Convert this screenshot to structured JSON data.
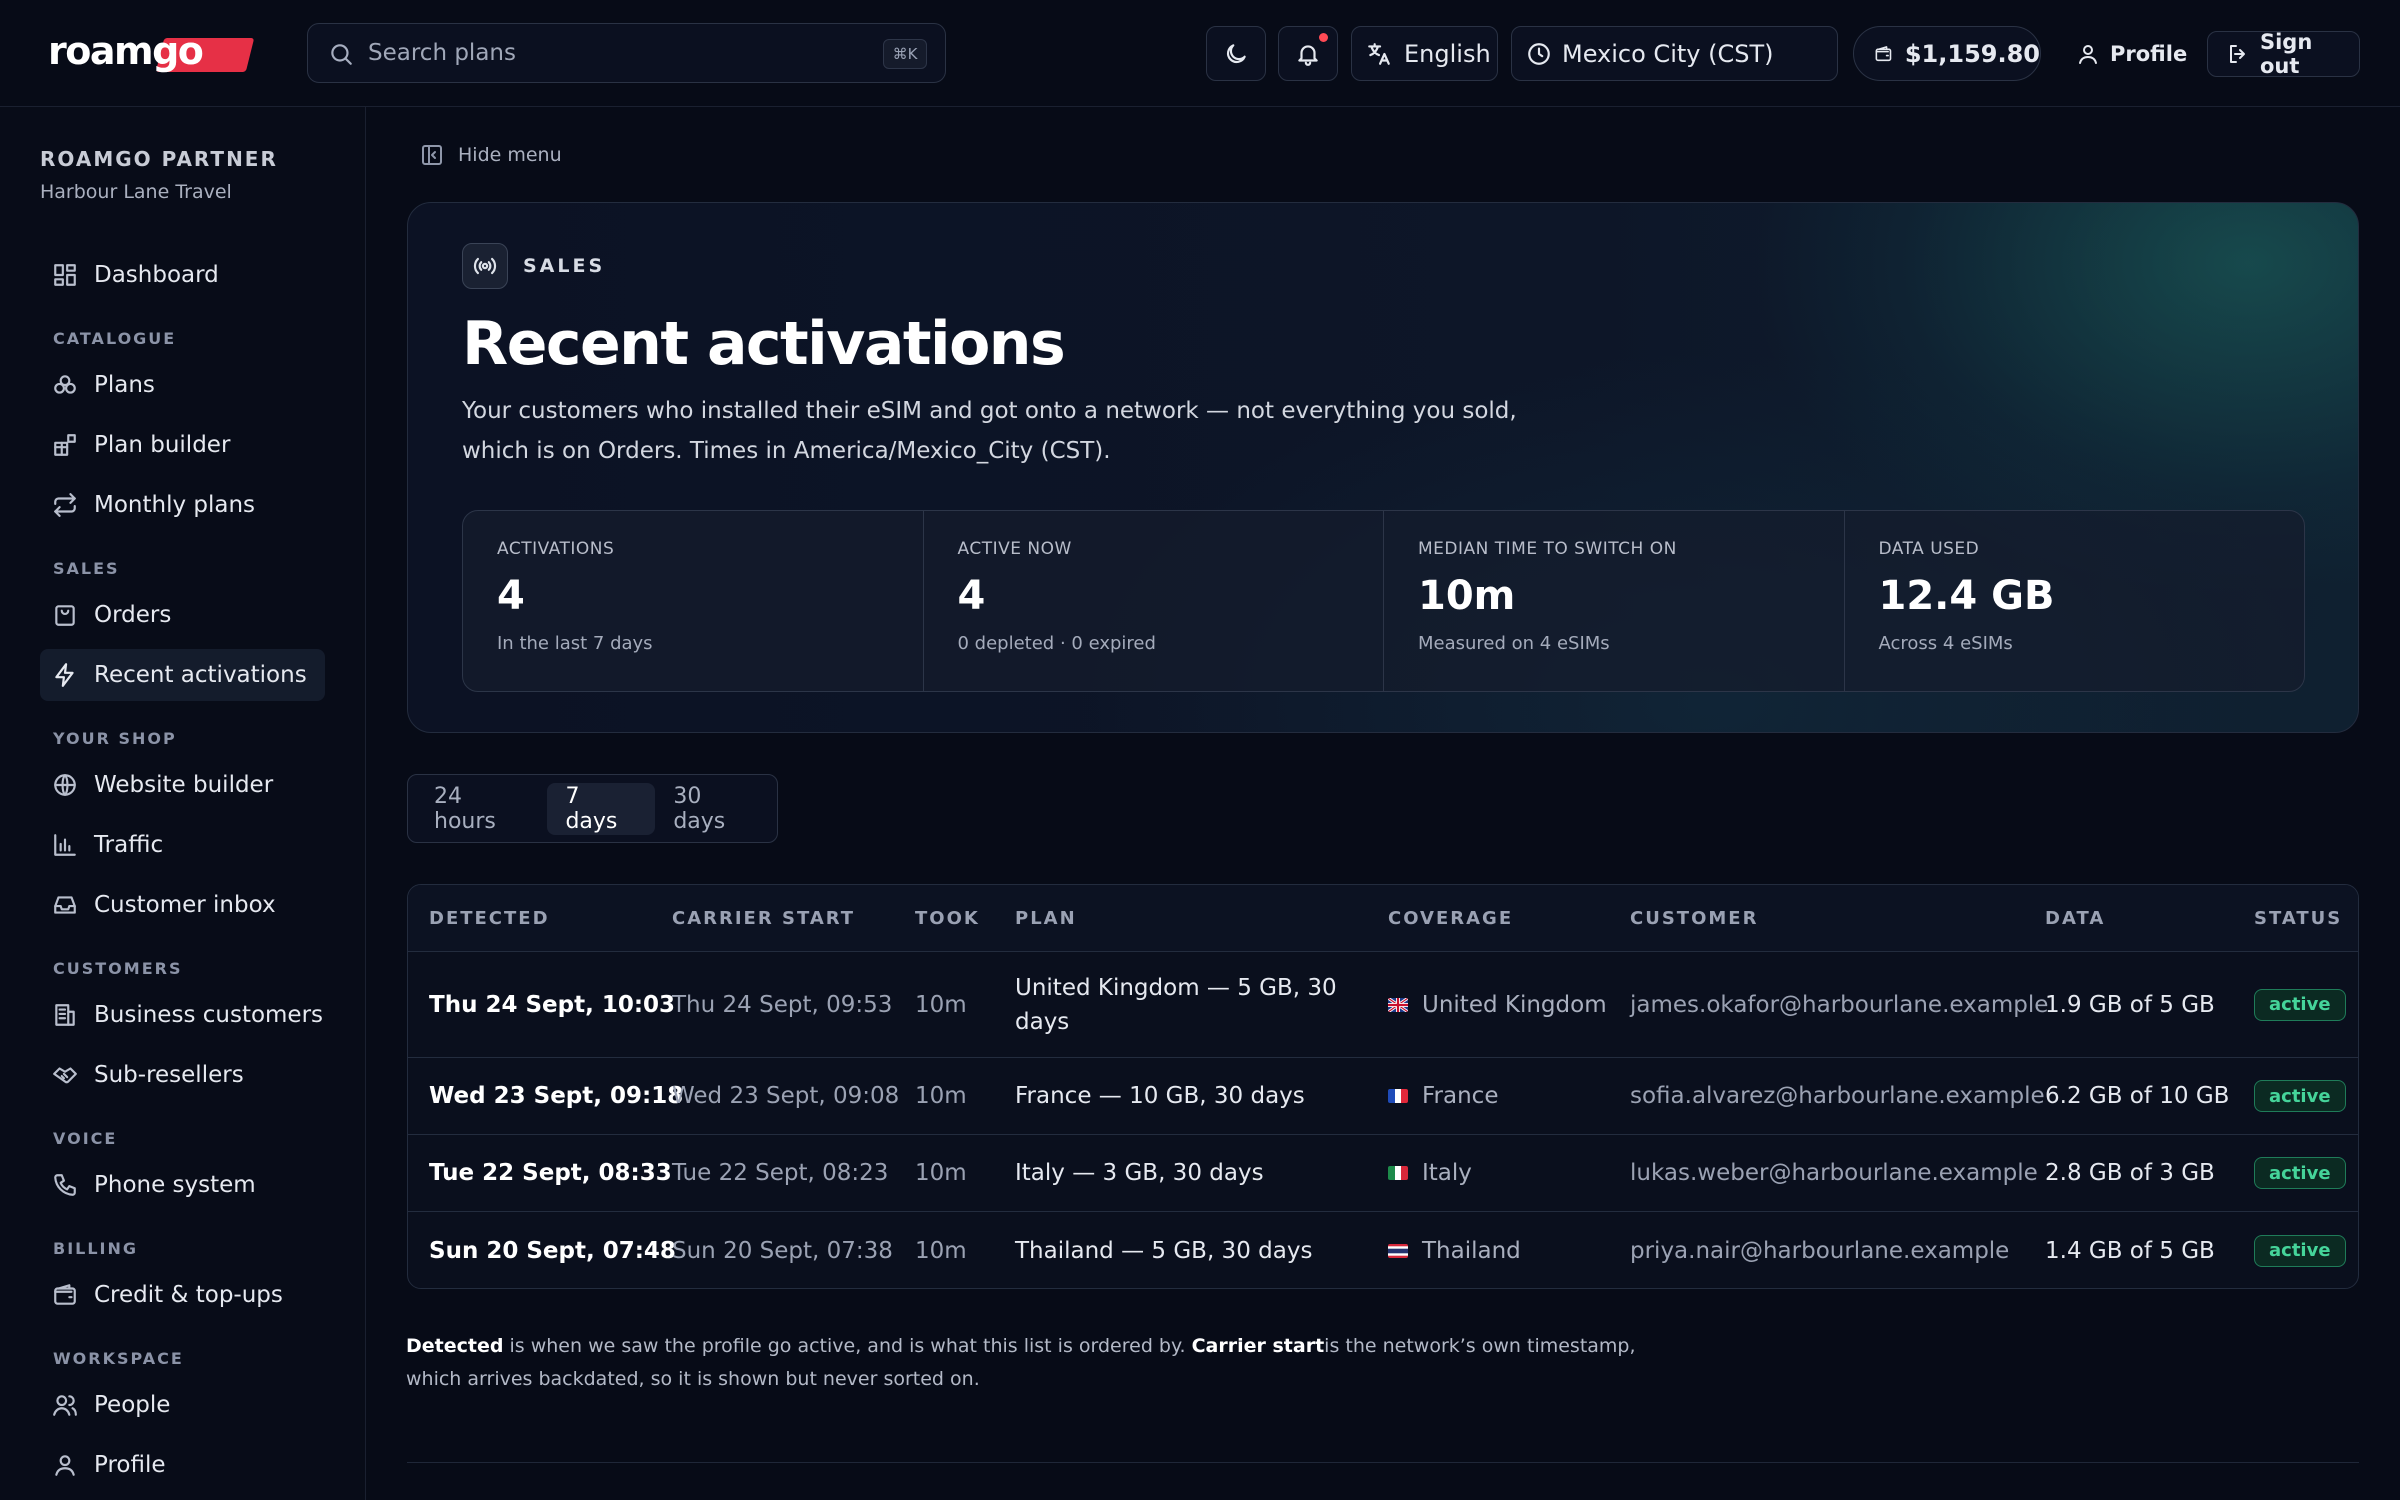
{
  "topbar": {
    "logo_text": "roamgo",
    "search_placeholder": "Search plans",
    "search_shortcut": "⌘K",
    "language": "English",
    "timezone": "Mexico City (CST)",
    "balance": "$1,159.80",
    "profile_label": "Profile",
    "signout_label": "Sign out",
    "notification_dot_color": "#ff4a55"
  },
  "sidebar": {
    "partner_label": "ROAMGO PARTNER",
    "partner_name": "Harbour Lane Travel",
    "dashboard": "Dashboard",
    "sections": {
      "catalogue": "CATALOGUE",
      "sales": "SALES",
      "your_shop": "YOUR SHOP",
      "customers": "CUSTOMERS",
      "voice": "VOICE",
      "billing": "BILLING",
      "workspace": "WORKSPACE"
    },
    "items": {
      "plans": "Plans",
      "plan_builder": "Plan builder",
      "monthly_plans": "Monthly plans",
      "orders": "Orders",
      "recent_activations": "Recent activations",
      "website_builder": "Website builder",
      "traffic": "Traffic",
      "customer_inbox": "Customer inbox",
      "business_customers": "Business customers",
      "sub_resellers": "Sub-resellers",
      "phone_system": "Phone system",
      "credit_topups": "Credit & top-ups",
      "people": "People",
      "profile": "Profile"
    },
    "active_item": "recent_activations"
  },
  "main": {
    "hide_menu": "Hide menu",
    "hero": {
      "eyebrow": "SALES",
      "title": "Recent activations",
      "description": "Your customers who installed their eSIM and got onto a network — not everything you sold, which is on Orders. Times in America/Mexico_City (CST)."
    },
    "stats": [
      {
        "label": "ACTIVATIONS",
        "value": "4",
        "sub": "In the last 7 days"
      },
      {
        "label": "ACTIVE NOW",
        "value": "4",
        "sub": "0 depleted · 0 expired"
      },
      {
        "label": "MEDIAN TIME TO SWITCH ON",
        "value": "10m",
        "sub": "Measured on 4 eSIMs"
      },
      {
        "label": "DATA USED",
        "value": "12.4 GB",
        "sub": "Across 4 eSIMs"
      }
    ],
    "range_tabs": [
      "24 hours",
      "7 days",
      "30 days"
    ],
    "range_selected": "7 days",
    "table": {
      "headers": [
        "DETECTED",
        "CARRIER START",
        "TOOK",
        "PLAN",
        "COVERAGE",
        "CUSTOMER",
        "DATA",
        "STATUS"
      ],
      "rows": [
        {
          "detected": "Thu 24 Sept, 10:03",
          "carrier_start": "Thu 24 Sept, 09:53",
          "took": "10m",
          "plan": "United Kingdom — 5 GB, 30 days",
          "coverage": "United Kingdom",
          "flag": "gb",
          "customer": "james.okafor@harbourlane.example",
          "data": "1.9 GB of 5 GB",
          "status": "active"
        },
        {
          "detected": "Wed 23 Sept, 09:18",
          "carrier_start": "Wed 23 Sept, 09:08",
          "took": "10m",
          "plan": "France — 10 GB, 30 days",
          "coverage": "France",
          "flag": "fr",
          "customer": "sofia.alvarez@harbourlane.example",
          "data": "6.2 GB of 10 GB",
          "status": "active"
        },
        {
          "detected": "Tue 22 Sept, 08:33",
          "carrier_start": "Tue 22 Sept, 08:23",
          "took": "10m",
          "plan": "Italy — 3 GB, 30 days",
          "coverage": "Italy",
          "flag": "it",
          "customer": "lukas.weber@harbourlane.example",
          "data": "2.8 GB of 3 GB",
          "status": "active"
        },
        {
          "detected": "Sun 20 Sept, 07:48",
          "carrier_start": "Sun 20 Sept, 07:38",
          "took": "10m",
          "plan": "Thailand — 5 GB, 30 days",
          "coverage": "Thailand",
          "flag": "th",
          "customer": "priya.nair@harbourlane.example",
          "data": "1.4 GB of 5 GB",
          "status": "active"
        }
      ]
    },
    "footnote": {
      "term1": "Detected",
      "text1": " is when we saw the profile go active, and is what this list is ordered by. ",
      "term2": "Carrier start",
      "text2": "is the network’s own timestamp, which arrives backdated, so it is shown but never sorted on."
    }
  },
  "colors": {
    "background": "#070b17",
    "accent_red": "#e63046",
    "status_active": "#45d49a"
  }
}
